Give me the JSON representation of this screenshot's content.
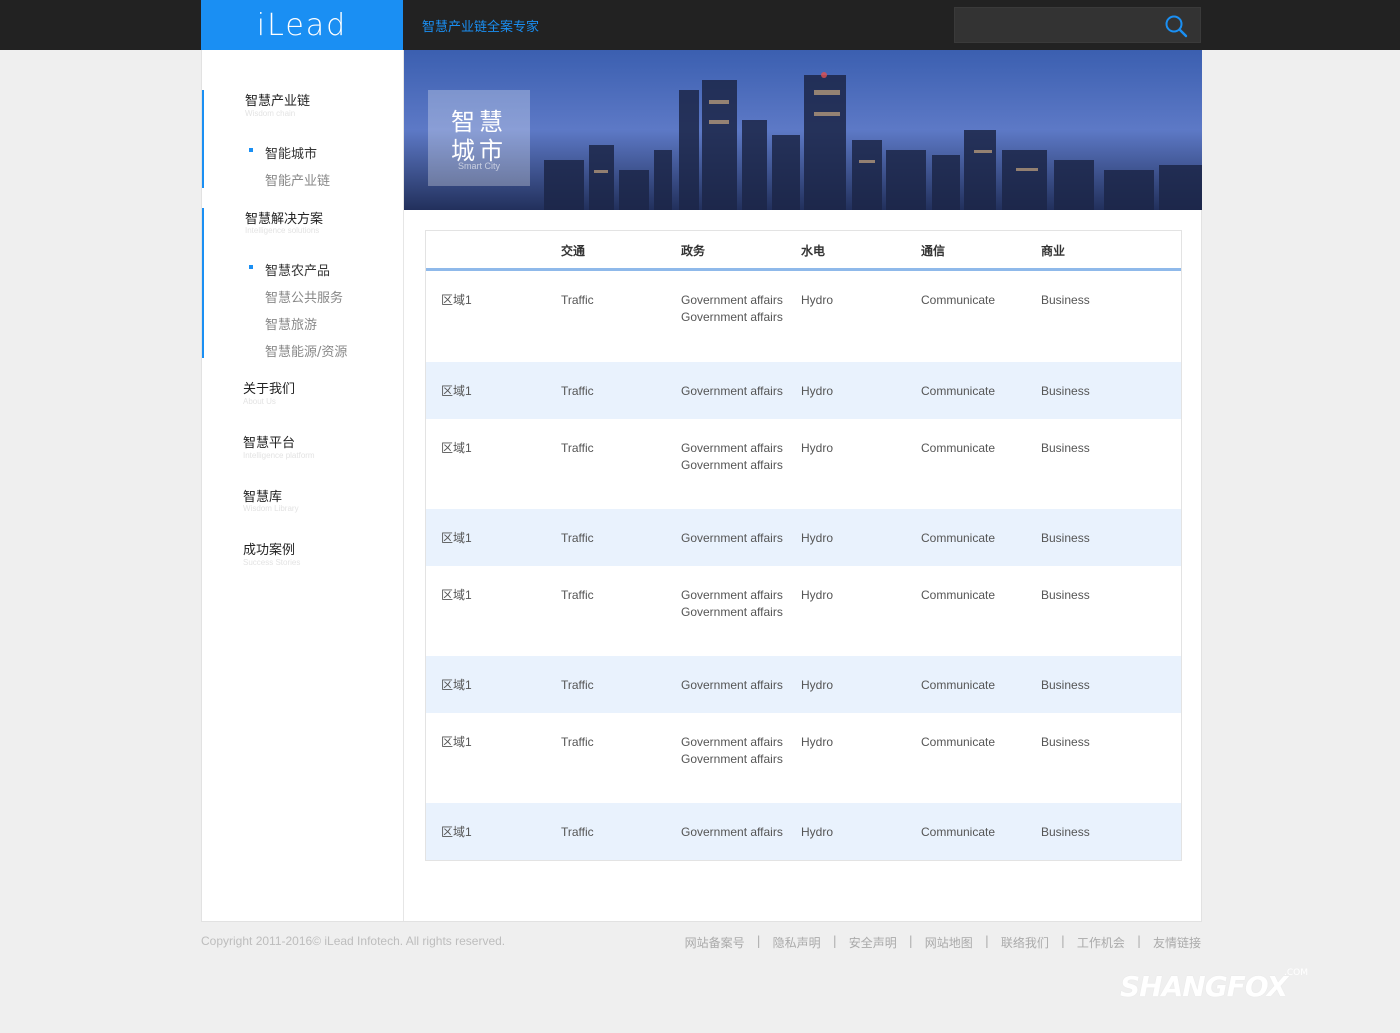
{
  "header": {
    "logo": "iLead",
    "slogan": "智慧产业链全案专家",
    "search_placeholder": ""
  },
  "sidebar": {
    "groups": [
      {
        "title": "智慧产业链",
        "subtitle": "Wisdom chain",
        "items": [
          {
            "label": "智能城市",
            "current": true
          },
          {
            "label": "智能产业链",
            "current": false
          }
        ]
      },
      {
        "title": "智慧解决方案",
        "subtitle": "Intelligence solutions",
        "items": [
          {
            "label": "智慧农产品",
            "current": true
          },
          {
            "label": "智慧公共服务",
            "current": false
          },
          {
            "label": "智慧旅游",
            "current": false
          },
          {
            "label": "智慧能源/资源",
            "current": false
          }
        ]
      },
      {
        "title": "关于我们",
        "subtitle": "About Us",
        "items": []
      },
      {
        "title": "智慧平台",
        "subtitle": "Intelligence platform",
        "items": []
      },
      {
        "title": "智慧库",
        "subtitle": "Wisdom Library",
        "items": []
      },
      {
        "title": "成功案例",
        "subtitle": "Success Stories",
        "items": []
      }
    ]
  },
  "banner": {
    "title_line1": "智慧",
    "title_line2": "城市",
    "subtitle": "Smart City"
  },
  "table": {
    "headers": [
      "",
      "交通",
      "政务",
      "水电",
      "通信",
      "商业"
    ],
    "rows": [
      [
        "区域1",
        "Traffic",
        "Government affairsGovernment affairs",
        "Hydro",
        "Communicate",
        "Business"
      ],
      [
        "区域1",
        "Traffic",
        "Government affairs",
        "Hydro",
        "Communicate",
        "Business"
      ],
      [
        "区域1",
        "Traffic",
        "Government affairsGovernment affairs",
        "Hydro",
        "Communicate",
        "Business"
      ],
      [
        "区域1",
        "Traffic",
        "Government affairs",
        "Hydro",
        "Communicate",
        "Business"
      ],
      [
        "区域1",
        "Traffic",
        "Government affairsGovernment affairs",
        "Hydro",
        "Communicate",
        "Business"
      ],
      [
        "区域1",
        "Traffic",
        "Government affairs",
        "Hydro",
        "Communicate",
        "Business"
      ],
      [
        "区域1",
        "Traffic",
        "Government affairsGovernment affairs",
        "Hydro",
        "Communicate",
        "Business"
      ],
      [
        "区域1",
        "Traffic",
        "Government affairs",
        "Hydro",
        "Communicate",
        "Business"
      ]
    ]
  },
  "footer": {
    "copyright": "Copyright 2011-2016© iLead Infotech. All rights reserved.",
    "links": [
      "网站备案号",
      "隐私声明",
      "安全声明",
      "网站地图",
      "联络我们",
      "工作机会",
      "友情链接"
    ]
  },
  "watermark": {
    "text": "SHANGFOX",
    "suffix": ".COM"
  },
  "colors": {
    "accent": "#1a8ff3",
    "topbar": "#222222",
    "row_alt": "#e9f2fd",
    "table_header_border": "#8fb9ea"
  }
}
